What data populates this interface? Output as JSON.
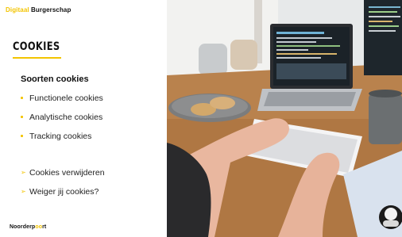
{
  "brand": {
    "part1": "Digitaal",
    "part2": " Burgerschap"
  },
  "title": "COOKIES",
  "section_heading": "Soorten cookies",
  "types": [
    "Functionele cookies",
    "Analytische cookies",
    "Tracking cookies"
  ],
  "actions": [
    "Cookies verwijderen",
    "Weiger jij cookies?"
  ],
  "footer": {
    "part1": "Noorderp",
    "part2": "oo",
    "part3": "rt"
  },
  "colors": {
    "accent": "#f3c400",
    "text": "#111111"
  },
  "photo_icons": [
    "laptop-icon",
    "keyboard-icon",
    "cookie-plate-icon",
    "mug-icon",
    "avatar-icon"
  ]
}
